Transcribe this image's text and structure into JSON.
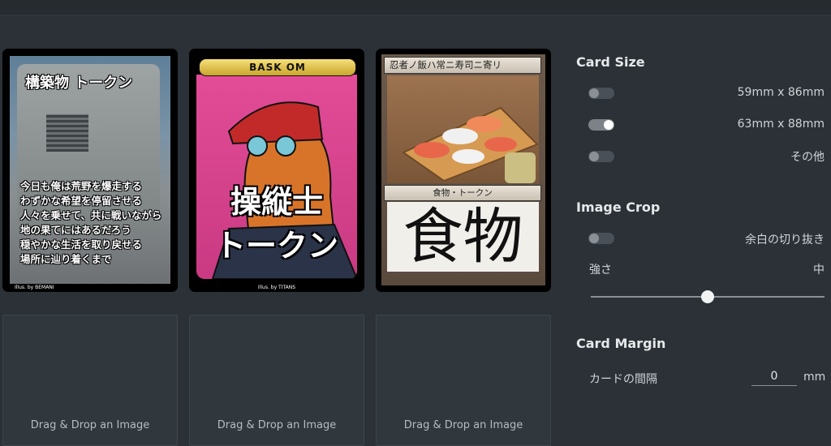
{
  "cards": [
    {
      "title": "構築物 トークン",
      "flavor": [
        "今日も俺は荒野を爆走する",
        "わずかな希望を停留させる",
        "人々を乗せて、共に戦いながら",
        "地の果てにはあるだろう",
        "穏やかな生活を取り戻せる",
        "場所に辿り着くまで"
      ],
      "credit": "Illus. by BEMANI"
    },
    {
      "header": "BASK  OM",
      "big_lines": [
        "操縦士",
        "トークン"
      ],
      "credit": "Illus. by TITANS"
    },
    {
      "name": "忍者ノ飯ハ常ニ寿司ニ寄リ",
      "type": "食物・トークン",
      "text": "食物"
    }
  ],
  "dropzones": [
    "Drag & Drop an Image",
    "Drag & Drop an Image",
    "Drag & Drop an Image"
  ],
  "settings": {
    "card_size": {
      "heading": "Card Size",
      "options": [
        {
          "label": "59mm x 86mm",
          "on": false
        },
        {
          "label": "63mm x 88mm",
          "on": true
        },
        {
          "label": "その他",
          "on": false
        }
      ]
    },
    "image_crop": {
      "heading": "Image Crop",
      "trim_label": "余白の切り抜き",
      "strength_label": "強さ",
      "strength_value": "中",
      "slider_fraction": 0.5
    },
    "card_margin": {
      "heading": "Card Margin",
      "gap_label": "カードの間隔",
      "gap_value": "0",
      "unit": "mm"
    }
  }
}
